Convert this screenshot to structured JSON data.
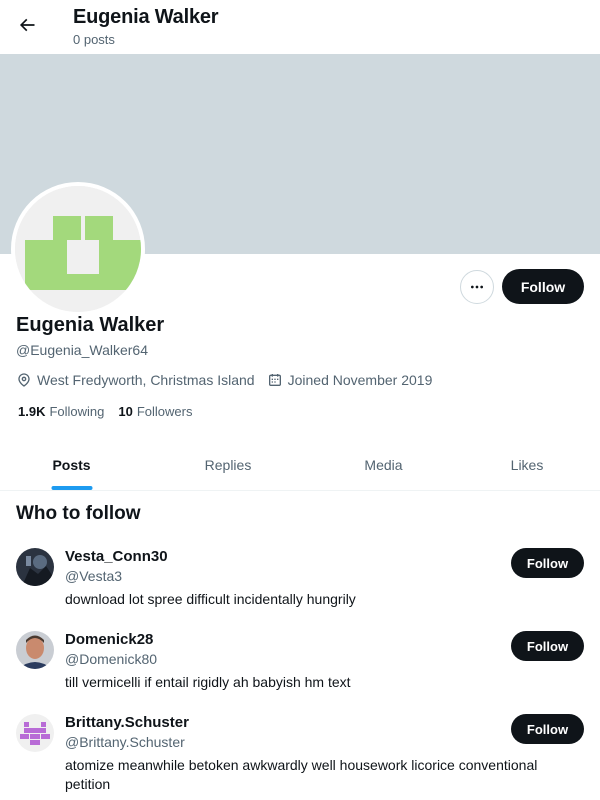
{
  "header": {
    "title": "Eugenia Walker",
    "posts_count": "0 posts"
  },
  "profile": {
    "name": "Eugenia Walker",
    "handle": "@Eugenia_Walker64",
    "location": "West Fredyworth, Christmas Island",
    "joined": "Joined November 2019",
    "following_count": "1.9K",
    "following_label": "Following",
    "followers_count": "10",
    "followers_label": "Followers",
    "follow_label": "Follow",
    "banner_color": "#cfd9de",
    "avatar_color": "#a3d97c"
  },
  "tabs": [
    {
      "label": "Posts",
      "active": true
    },
    {
      "label": "Replies",
      "active": false
    },
    {
      "label": "Media",
      "active": false
    },
    {
      "label": "Likes",
      "active": false
    }
  ],
  "who_to_follow": {
    "title": "Who to follow",
    "users": [
      {
        "name": "Vesta_Conn30",
        "handle": "@Vesta3",
        "bio": "download lot spree difficult incidentally hungrily",
        "follow_label": "Follow"
      },
      {
        "name": "Domenick28",
        "handle": "@Domenick80",
        "bio": "till vermicelli if entail rigidly ah babyish hm text",
        "follow_label": "Follow"
      },
      {
        "name": "Brittany.Schuster",
        "handle": "@Brittany.Schuster",
        "bio": "atomize meanwhile betoken awkwardly well housework licorice conventional petition",
        "follow_label": "Follow"
      }
    ]
  },
  "colors": {
    "accent": "#1d9bf0",
    "text_primary": "#0f1419",
    "text_secondary": "#536471",
    "button_dark": "#0f1419"
  }
}
